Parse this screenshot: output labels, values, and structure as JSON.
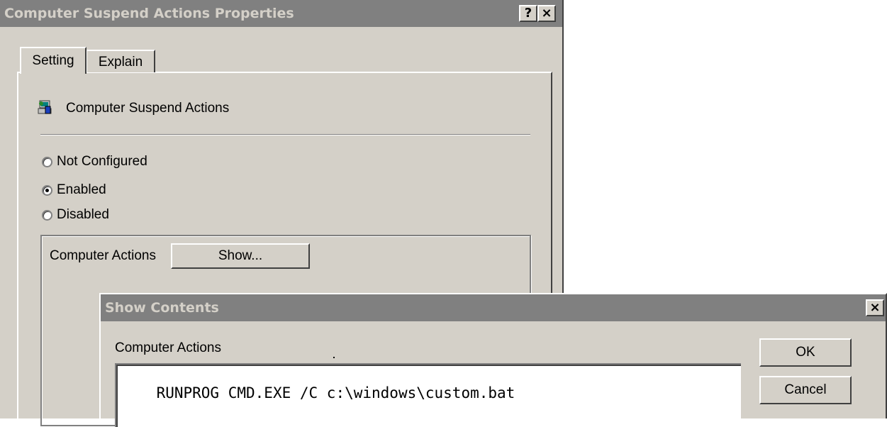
{
  "properties_dialog": {
    "title": "Computer Suspend Actions Properties",
    "help_button": "?",
    "close_button": "×",
    "tabs": [
      {
        "label": "Setting",
        "active": true
      },
      {
        "label": "Explain",
        "active": false
      }
    ],
    "policy_icon": "policy-computer-icon",
    "policy_name": "Computer Suspend Actions",
    "options": [
      {
        "label": "Not Configured",
        "selected": false
      },
      {
        "label": "Enabled",
        "selected": true
      },
      {
        "label": "Disabled",
        "selected": false
      }
    ],
    "actions_label": "Computer Actions",
    "show_button": "Show..."
  },
  "show_contents_dialog": {
    "title": "Show Contents",
    "close_button": "×",
    "list_label": "Computer Actions",
    "entries": [
      "RUNPROG CMD.EXE /C c:\\windows\\custom.bat"
    ],
    "ok_button": "OK",
    "cancel_button": "Cancel"
  },
  "colors": {
    "dialog_face": "#d4d0c8",
    "inactive_titlebar": "#808080",
    "inactive_title_text": "#d4d0c8"
  }
}
